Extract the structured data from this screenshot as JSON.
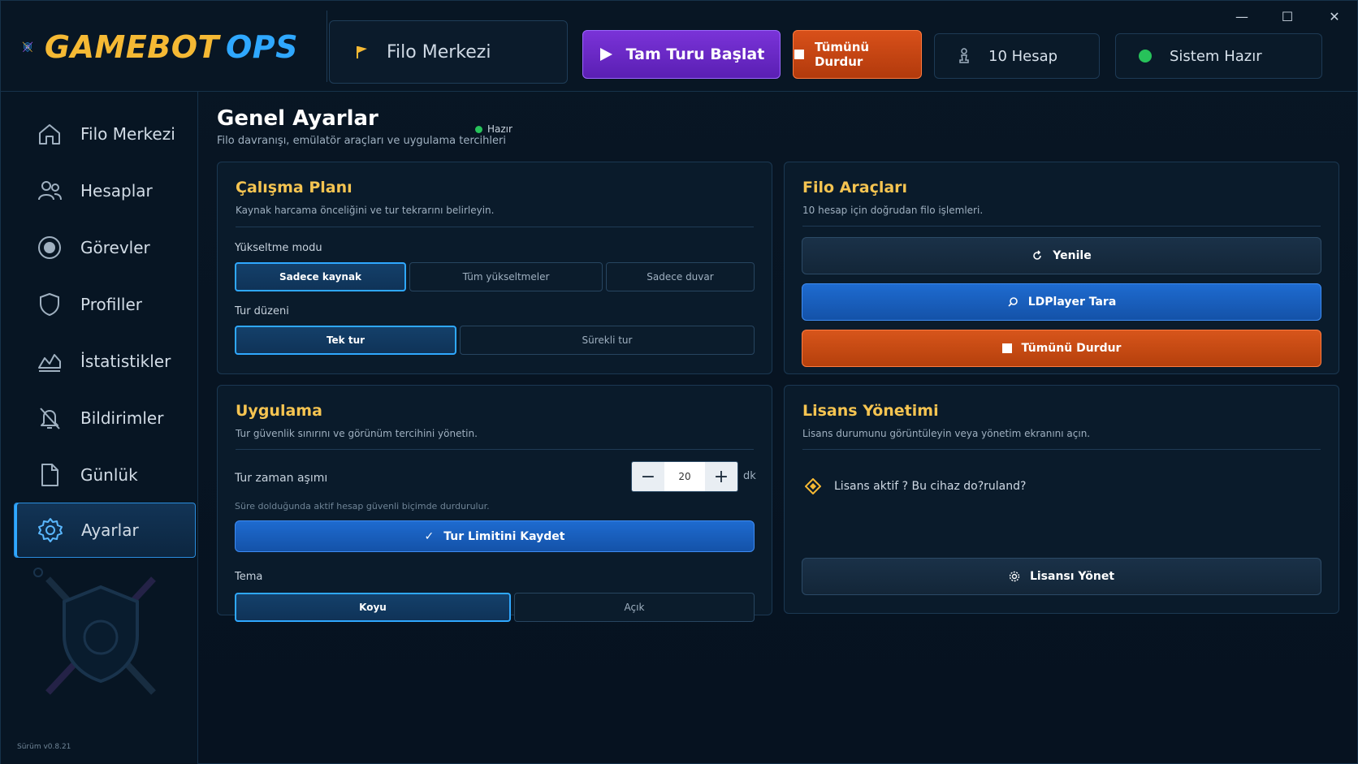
{
  "app": {
    "logo_primary": "GAMEBOT",
    "logo_secondary": "OPS"
  },
  "topbar": {
    "current_view": "Filo Merkezi",
    "start_label": "Tam Turu Başlat",
    "stop_label": "Tümünü Durdur",
    "accounts_label": "10 Hesap",
    "system_label": "Sistem Hazır",
    "window_min": "—",
    "window_max": "☐",
    "window_close": "✕"
  },
  "sidebar": {
    "items": [
      {
        "label": "Filo Merkezi",
        "icon": "home-icon"
      },
      {
        "label": "Hesaplar",
        "icon": "users-icon"
      },
      {
        "label": "Görevler",
        "icon": "target-icon"
      },
      {
        "label": "Profiller",
        "icon": "shield-icon"
      },
      {
        "label": "İstatistikler",
        "icon": "chart-icon"
      },
      {
        "label": "Bildirimler",
        "icon": "bell-off-icon"
      },
      {
        "label": "Günlük",
        "icon": "file-icon"
      },
      {
        "label": "Ayarlar",
        "icon": "gear-icon",
        "active": true
      }
    ],
    "version": "Sürüm v0.8.21"
  },
  "page": {
    "title": "Genel Ayarlar",
    "subtitle": "Filo davranışı, emülatör araçları ve uygulama tercihleri",
    "status": "Hazır"
  },
  "work_plan": {
    "title": "Çalışma Planı",
    "subtitle": "Kaynak harcama önceliğini ve tur tekrarını belirleyin.",
    "upgrade_label": "Yükseltme modu",
    "upgrade_options": [
      "Sadece kaynak",
      "Tüm yükseltmeler",
      "Sadece duvar"
    ],
    "tour_label": "Tur düzeni",
    "tour_options": [
      "Tek tur",
      "Sürekli tur"
    ]
  },
  "fleet_tools": {
    "title": "Filo Araçları",
    "subtitle": "10 hesap için doğrudan filo işlemleri.",
    "refresh_label": "Yenile",
    "scan_label": "LDPlayer Tara",
    "stop_label": "Tümünü Durdur"
  },
  "application": {
    "title": "Uygulama",
    "subtitle": "Tur güvenlik sınırını ve görünüm tercihini yönetin.",
    "timeout_label": "Tur zaman aşımı",
    "timeout_value": "20",
    "timeout_unit": "dk",
    "minus": "−",
    "plus": "+",
    "timeout_hint": "Süre dolduğunda aktif hesap güvenli biçimde durdurulur.",
    "save_label": "Tur Limitini Kaydet",
    "theme_label": "Tema",
    "theme_options": [
      "Koyu",
      "Açık"
    ]
  },
  "license": {
    "title": "Lisans Yönetimi",
    "subtitle": "Lisans durumunu görüntüleyin veya yönetim ekranını açın.",
    "status_text": "Lisans aktif ? Bu cihaz do?ruland?",
    "manage_label": "Lisansı Yönet"
  },
  "colors": {
    "accent_blue": "#2fa8ff",
    "accent_gold": "#f5c451",
    "purple": "#7a33d8",
    "orange": "#d7551b",
    "green": "#27c25a"
  }
}
